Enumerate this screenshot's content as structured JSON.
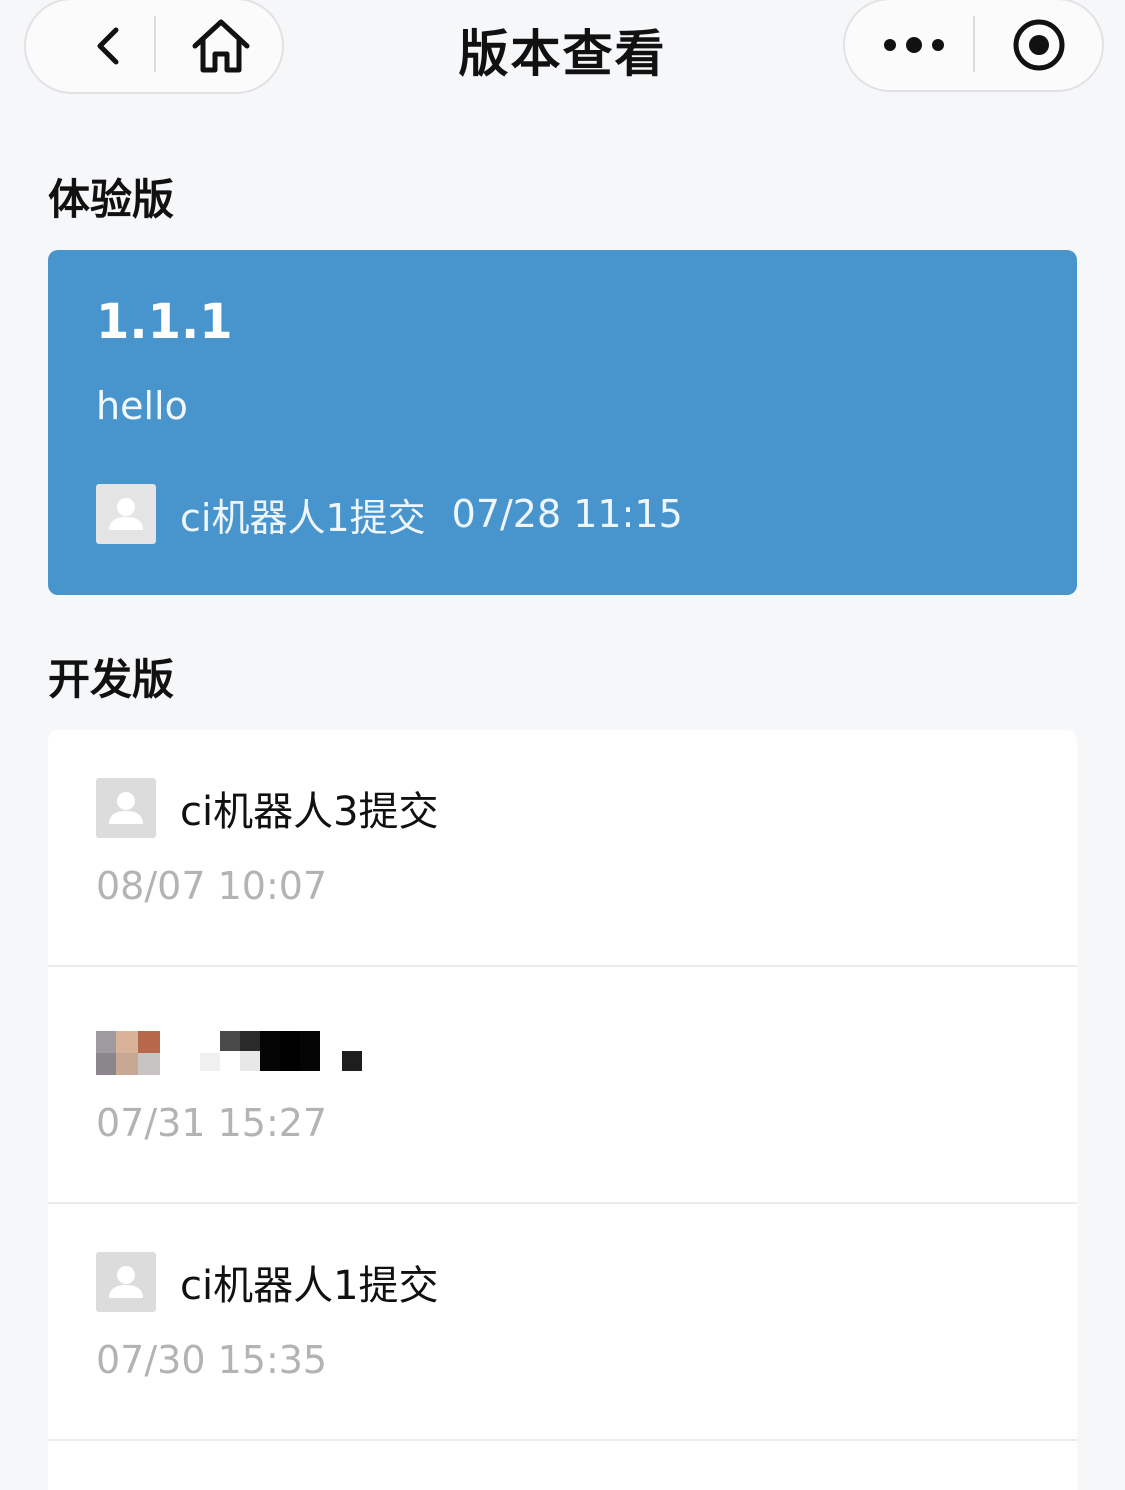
{
  "nav": {
    "title": "版本查看",
    "back_icon": "chevron-left-icon",
    "home_icon": "home-icon",
    "more_icon": "more-dots-icon",
    "close_icon": "target-circle-icon"
  },
  "trial": {
    "section_title": "体验版",
    "version": "1.1.1",
    "description": "hello",
    "submitter": "ci机器人1提交",
    "time": "07/28 11:15",
    "card_color": "#4895cd"
  },
  "dev": {
    "section_title": "开发版",
    "items": [
      {
        "author": "ci机器人3提交",
        "time": "08/07 10:07",
        "avatar": "default-avatar"
      },
      {
        "author": "",
        "time": "07/31 15:27",
        "avatar": "photo-avatar-redacted"
      },
      {
        "author": "ci机器人1提交",
        "time": "07/30 15:35",
        "avatar": "default-avatar"
      }
    ]
  }
}
